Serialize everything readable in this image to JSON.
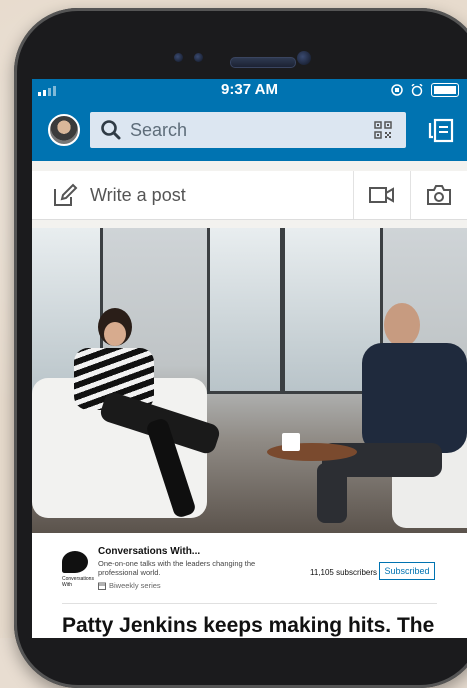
{
  "status_bar": {
    "time": "9:37 AM"
  },
  "search": {
    "placeholder": "Search"
  },
  "compose": {
    "write_label": "Write a post"
  },
  "series": {
    "name": "Conversations With...",
    "description": "One-on-one talks with the leaders changing the professional world.",
    "frequency": "Biweekly series",
    "logo_text": "Conversations With",
    "subscribers": "11,105 subscribers",
    "subscribe_button": "Subscribed"
  },
  "article": {
    "headline": "Patty Jenkins keeps making hits. The costs of not doing so are too high"
  },
  "colors": {
    "brand": "#0073b1",
    "search_bg": "#dce6f1",
    "feed_bg": "#f3f2ef"
  },
  "icons": [
    "search-icon",
    "qr-code-icon",
    "messaging-icon",
    "pencil-icon",
    "video-icon",
    "camera-icon",
    "calendar-icon"
  ]
}
